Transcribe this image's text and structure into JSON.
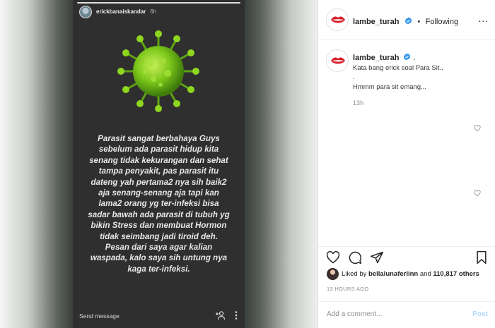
{
  "story": {
    "username": "erickbanaiskandar",
    "time": "6h",
    "text": "Parasit sangat berbahaya Guys\nsebelum ada parasit hidup kita\nsenang tidak kekurangan dan sehat\ntampa penyakit, pas parasit itu\ndateng yah pertama2 nya sih baik2\naja senang-senang aja tapi kan\nlama2 orang yg ter-infeksi bisa\nsadar bawah ada parasit di tubuh yg\nbikin Stress dan membuat Hormon\ntidak seimbang jadi tiroid deh.\nPesan dari saya agar kalian\nwaspada, kalo saya sih untung nya\nkaga ter-infeksi.",
    "send_message_placeholder": "Send message"
  },
  "header": {
    "username": "lambe_turah",
    "dot": "•",
    "follow_status": "Following",
    "more": "..."
  },
  "caption": {
    "username": "lambe_turah",
    "suffix": ".",
    "line1": "Kata bang erick soal Para Sit..",
    "line2": ".",
    "line3": "Hmmm para sit emang...",
    "time": "13h"
  },
  "likes": {
    "prefix": "Liked by ",
    "user": "bellalunaferlinn",
    "middle": " and ",
    "count": "110,817 others"
  },
  "post_time": "13 HOURS AGO",
  "comment": {
    "placeholder": "Add a comment...",
    "post_label": "Post"
  },
  "colors": {
    "verified": "#3897f0",
    "virus": "#7cc61a",
    "brand_lips": "#d6202a"
  },
  "icons": [
    "verified-badge-icon",
    "virus-icon",
    "add-person-icon",
    "more-vert-icon",
    "heart-icon",
    "comment-icon",
    "share-icon",
    "bookmark-icon"
  ]
}
